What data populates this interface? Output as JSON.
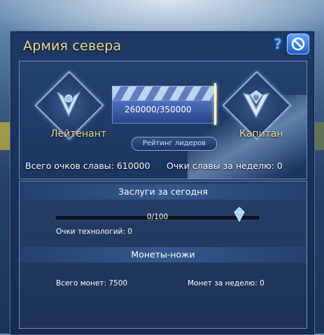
{
  "window": {
    "title": "Армия севера",
    "help_symbol": "?"
  },
  "rank": {
    "current_label": "Лейтенант",
    "next_label": "Капитан",
    "progress_text": "260000/350000",
    "progress_fraction": 0.743,
    "leaders_button": "Рейтинг лидеров"
  },
  "glory": {
    "total_text": "Всего очков славы: 610000",
    "week_text": "Очки славы за неделю: 0"
  },
  "merits": {
    "header": "Заслуги за сегодня",
    "progress_text": "0/100",
    "progress_fraction": 0,
    "tech_points": "Очки технологий: 0"
  },
  "coins": {
    "header": "Монеты-ножи",
    "total": "Всего монет: 7500",
    "week": "Монет за неделю: 0"
  },
  "icons": {
    "help": "help-icon",
    "close": "close-icon",
    "rank_current": "lieutenant-emblem-icon",
    "rank_next": "captain-emblem-icon",
    "gem": "crystal-gem-icon"
  },
  "colors": {
    "title": "#f1dca0",
    "accent": "#5fb0ff"
  }
}
